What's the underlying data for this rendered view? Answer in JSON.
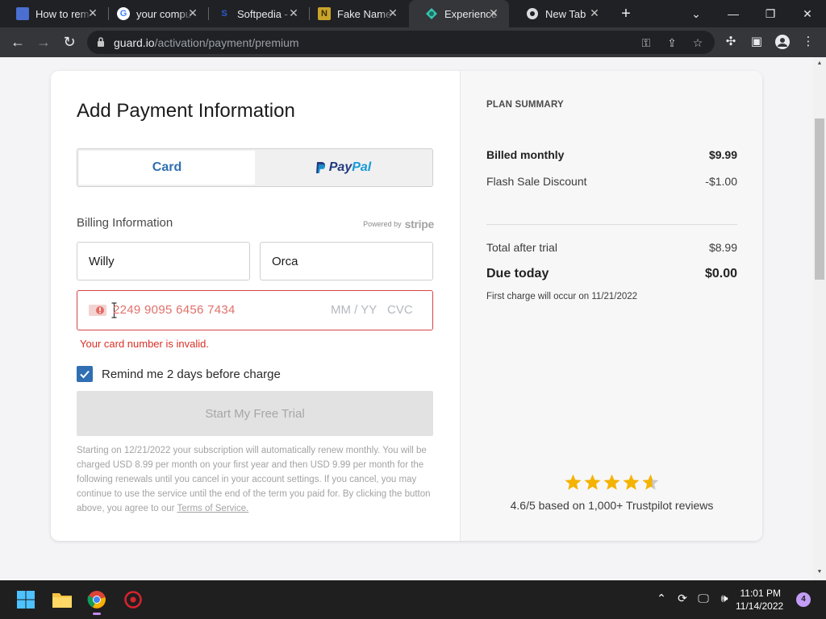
{
  "browser": {
    "tabs": [
      {
        "title": "How to rem",
        "icon": "doc-icon"
      },
      {
        "title": "your compu",
        "icon": "google-icon"
      },
      {
        "title": "Softpedia -",
        "icon": "softpedia-icon"
      },
      {
        "title": "Fake Name",
        "icon": "fakename-icon"
      },
      {
        "title": "Experience",
        "icon": "guardio-icon",
        "active": true
      },
      {
        "title": "New Tab",
        "icon": "chrome-icon"
      }
    ],
    "url_host": "guard.io",
    "url_path": "/activation/payment/premium"
  },
  "form": {
    "title": "Add Payment Information",
    "tab_card": "Card",
    "tab_paypal_pay": "Pay",
    "tab_paypal_pal": "Pal",
    "billing_label": "Billing Information",
    "powered_by": "Powered by",
    "stripe": "stripe",
    "first_name": "Willy",
    "last_name": "Orca",
    "card_number": "2249 9095 6456 7434",
    "expiry_placeholder": "MM / YY",
    "cvc_placeholder": "CVC",
    "error": "Your card number is invalid.",
    "remind_label": "Remind me 2 days before charge",
    "remind_checked": true,
    "cta": "Start My Free Trial",
    "fine_print": "Starting on 12/21/2022 your subscription will automatically renew monthly. You will be charged USD 8.99 per month on your first year and then USD 9.99 per month for the following renewals until you cancel in your account settings. If you cancel, you may continue to use the service until the end of the term you paid for. By clicking the button above, you agree to our ",
    "terms_link": "Terms of Service."
  },
  "summary": {
    "heading": "PLAN SUMMARY",
    "billed_label": "Billed monthly",
    "billed_value": "$9.99",
    "discount_label": "Flash Sale Discount",
    "discount_value": "-$1.00",
    "total_label": "Total after trial",
    "total_value": "$8.99",
    "due_label": "Due today",
    "due_value": "$0.00",
    "first_charge": "First charge will occur on 11/21/2022",
    "rating_value": 4.6,
    "rating_text": "4.6/5 based on 1,000+ Trustpilot reviews"
  },
  "taskbar": {
    "time": "11:01 PM",
    "date": "11/14/2022",
    "notifications": "4"
  },
  "colors": {
    "accent": "#2f6fb2",
    "error": "#d93025",
    "star": "#f5b301"
  }
}
